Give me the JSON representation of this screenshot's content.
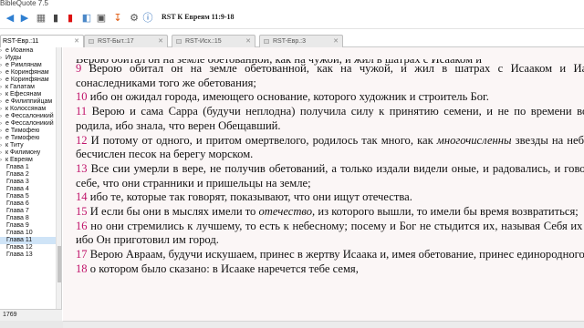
{
  "window": {
    "title": "BibleQuote 7.5"
  },
  "toolbar": {
    "icons": [
      "back-icon",
      "forward-icon",
      "book-icon",
      "bookmark-icon",
      "red-bookmark-icon",
      "copy-icon",
      "print-icon",
      "download-icon",
      "settings-icon",
      "info-icon",
      "search-icon"
    ],
    "reference": "RST К Евреям 11:9-18"
  },
  "tabs": [
    {
      "label": "RST-Евр.:11",
      "active": true
    },
    {
      "label": "RST-Быт.:17",
      "active": false
    },
    {
      "label": "RST-Исх.:15",
      "active": false
    },
    {
      "label": "RST-Евр.:3",
      "active": false
    }
  ],
  "sidebar": {
    "items": [
      {
        "label": "е Иоанна",
        "type": "book"
      },
      {
        "label": "Иуды",
        "type": "book"
      },
      {
        "label": "е Римлянам",
        "type": "book"
      },
      {
        "label": "е Коринфянам",
        "type": "book"
      },
      {
        "label": "е Коринфянам",
        "type": "book"
      },
      {
        "label": "к Галатам",
        "type": "book"
      },
      {
        "label": "к Ефесянам",
        "type": "book"
      },
      {
        "label": "е Филиппийцам",
        "type": "book"
      },
      {
        "label": "к Колоссянам",
        "type": "book"
      },
      {
        "label": "е Фессалоникий",
        "type": "book"
      },
      {
        "label": "е Фессалоникий",
        "type": "book"
      },
      {
        "label": "е Тимофею",
        "type": "book"
      },
      {
        "label": "е Тимофею",
        "type": "book"
      },
      {
        "label": "к Титу",
        "type": "book"
      },
      {
        "label": "к Филимону",
        "type": "book"
      },
      {
        "label": "к Евреям",
        "type": "book"
      },
      {
        "label": "Глава 1",
        "type": "chapter"
      },
      {
        "label": "Глава 2",
        "type": "chapter"
      },
      {
        "label": "Глава 3",
        "type": "chapter"
      },
      {
        "label": "Глава 4",
        "type": "chapter"
      },
      {
        "label": "Глава 5",
        "type": "chapter"
      },
      {
        "label": "Глава 6",
        "type": "chapter"
      },
      {
        "label": "Глава 7",
        "type": "chapter"
      },
      {
        "label": "Глава 8",
        "type": "chapter"
      },
      {
        "label": "Глава 9",
        "type": "chapter"
      },
      {
        "label": "Глава 10",
        "type": "chapter"
      },
      {
        "label": "Глава 11",
        "type": "chapter",
        "selected": true
      },
      {
        "label": "Глава 12",
        "type": "chapter"
      },
      {
        "label": "Глава 13",
        "type": "chapter"
      }
    ]
  },
  "status": {
    "count": "1769"
  },
  "reader": {
    "top_cut_text": "Верою обитал он на земле обетованной, как на чужой, и жил в шатрах с Исааком и",
    "verses": [
      {
        "num": "9",
        "text": "Верою обитал он на земле обетованной, как на чужой, и жил в шатрах с Исааком и Иаковом, сонаследниками того же обетования;"
      },
      {
        "num": "10",
        "text": "ибо он ожидал города, имеющего основание, которого художник и строитель Бог."
      },
      {
        "num": "11",
        "text": "Верою и сама Сарра (будучи неплодна) получила силу к принятию семени, и не по времени возраста родила, ибо знала, что верен Обещавший."
      },
      {
        "num": "12",
        "pre": "И потому от одного, и притом омертвелого, родилось так много, как ",
        "italic": "многочисленны",
        "post": " звезды на небе и как бесчислен песок на берегу морском."
      },
      {
        "num": "13",
        "text": "Все сии умерли в вере, не получив обетований, а только издали видели оные, и радовались, и говорили о себе, что они странники и пришельцы на земле;"
      },
      {
        "num": "14",
        "text": "ибо те, которые так говорят, показывают, что они ищут отечества."
      },
      {
        "num": "15",
        "pre": "И если бы они в мыслях имели то ",
        "italic": "отечество,",
        "post": " из которого вышли, то имели бы время возвратиться;"
      },
      {
        "num": "16",
        "text": "но они стремились к лучшему, то есть к небесному; посему и Бог не стыдится их, называя Себя их Богом: ибо Он приготовил им город."
      },
      {
        "num": "17",
        "text": "Верою Авраам, будучи искушаем, принес в жертву Исаака и, имея обетование, принес единородного,"
      },
      {
        "num": "18",
        "text": "о котором было сказано: в Исааке наречется тебе семя,"
      }
    ]
  }
}
